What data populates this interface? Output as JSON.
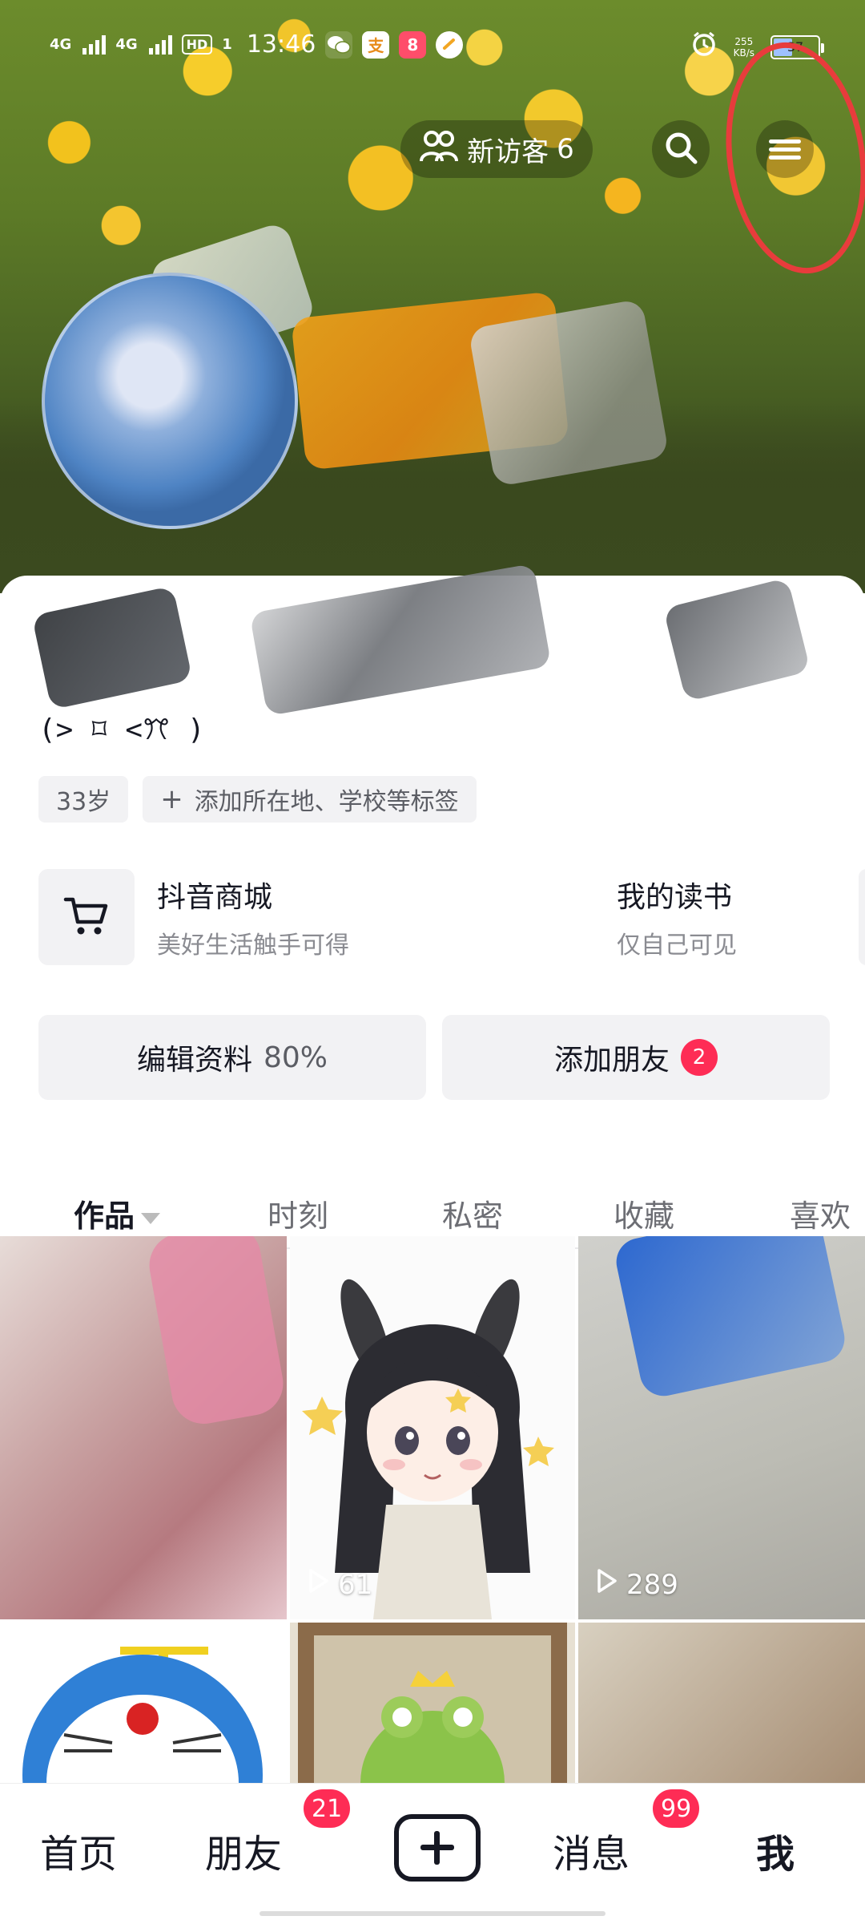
{
  "status_bar": {
    "signal1": "4G",
    "signal2": "4G",
    "hd": "HD",
    "subscript": "1",
    "time": "13:46",
    "speed_value": "255",
    "speed_unit": "KB/s",
    "battery": "37"
  },
  "header": {
    "visitor_label": "新访客",
    "visitor_count": "6"
  },
  "profile": {
    "signature": "(> ⌑ <ꔫ )",
    "age_tag": "33岁",
    "add_tag": "添加所在地、学校等标签"
  },
  "shortcuts": {
    "shop_title": "抖音商城",
    "shop_sub": "美好生活触手可得",
    "book_title": "我的读书",
    "book_sub": "仅自己可见"
  },
  "actions": {
    "edit_label": "编辑资料",
    "edit_percent": "80%",
    "add_friend_label": "添加朋友",
    "add_friend_badge": "2"
  },
  "tabs": [
    "作品",
    "时刻",
    "私密",
    "收藏",
    "喜欢"
  ],
  "grid": {
    "views_2": "61",
    "views_3": "289"
  },
  "bottom_nav": {
    "home": "首页",
    "friends": "朋友",
    "friends_badge": "21",
    "messages": "消息",
    "messages_badge": "99",
    "me": "我"
  },
  "colors": {
    "accent": "#fe2c55",
    "annotation": "#e83c3c"
  }
}
